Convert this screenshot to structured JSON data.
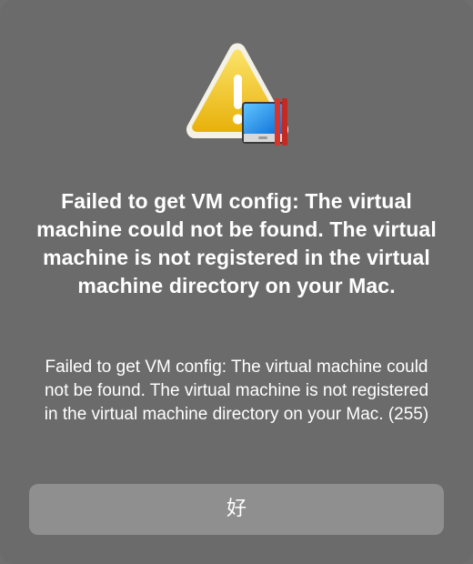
{
  "alert": {
    "icon": "warning-triangle-with-vm-icon",
    "title": "Failed to get VM config: The virtual machine could not be found. The virtual machine is not registered in the virtual machine directory on your Mac.",
    "message": "Failed to get VM config: The virtual machine could not be found. The virtual machine is not registered in the virtual machine directory on your Mac. (255)",
    "ok_label": "好"
  },
  "colors": {
    "background": "#6b6b6b",
    "button": "#8f8f8f",
    "warning_yellow": "#f5c518",
    "accent_red": "#d9342b",
    "screen_blue": "#1e90e6"
  }
}
